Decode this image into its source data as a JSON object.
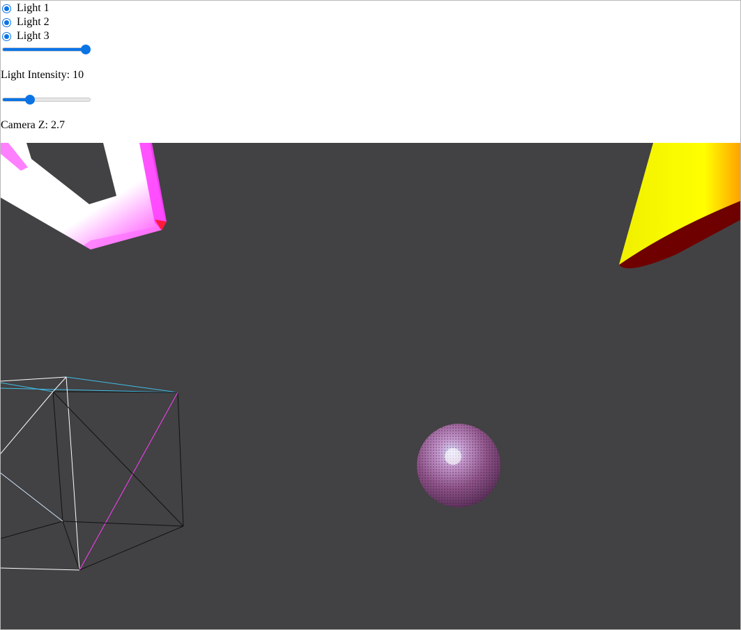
{
  "controls": {
    "lights": [
      {
        "label": "Light 1",
        "checked": true
      },
      {
        "label": "Light 2",
        "checked": true
      },
      {
        "label": "Light 3",
        "checked": true
      }
    ],
    "intensity_slider": {
      "value_fraction": 1.0
    },
    "intensity_readout": "Light Intensity: 10",
    "camera_slider": {
      "value_fraction": 0.29
    },
    "camera_readout": "Camera Z: 2.7"
  },
  "scene": {
    "background": "#424143",
    "objects": [
      "torus-knot",
      "cone",
      "wireframe-cube",
      "sphere"
    ],
    "colors": {
      "accent": "#0b74e5",
      "cone_yellow": "#ffff00",
      "cone_base": "#6e0000",
      "knot_magenta": "#ff40ff",
      "wire_cyan": "#3fbfe8",
      "wire_magenta": "#ff40ff"
    }
  }
}
